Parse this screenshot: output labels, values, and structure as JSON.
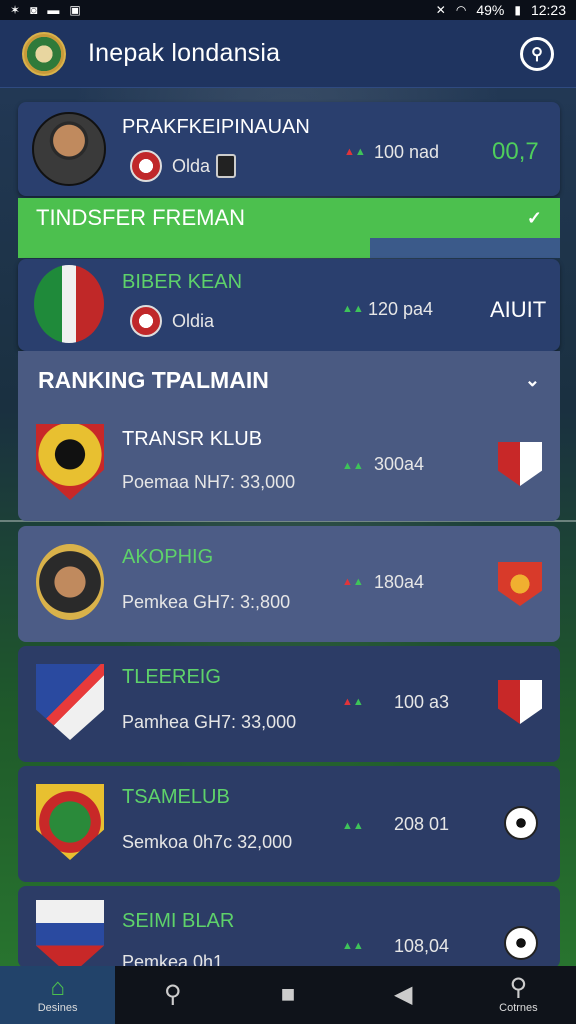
{
  "status": {
    "battery": "49%",
    "time": "12:23"
  },
  "header": {
    "title": "Inepak londansia"
  },
  "featured": {
    "name": "PRAKFKEIPINAUAN",
    "club": "Olda",
    "delta": "100 nad",
    "score": "00,7"
  },
  "transfer": {
    "title": "TINDSFER FREMAN",
    "progress": 0.65
  },
  "transfer_row": {
    "name": "BIBER KEAN",
    "club": "Oldia",
    "delta": "120 pa4",
    "score": "AIUIT"
  },
  "ranking": {
    "title": "RANKING TPALMAIN"
  },
  "rows": [
    {
      "name": "TRANSR KLUB",
      "sub": "Poemaa NH7: 33,000",
      "delta": "300a4"
    },
    {
      "name": "AKOPHIG",
      "sub": "Pemkea GH7: 3:,800",
      "delta": "180a4"
    },
    {
      "name": "TLEEREIG",
      "sub": "Pamhea GH7: 33,000",
      "delta": "100 a3"
    },
    {
      "name": "TSAMELUB",
      "sub": "Semkoa 0h7c 32,000",
      "delta": "208 01"
    },
    {
      "name": "SEIMI BLAR",
      "sub": "Pemkea 0h1",
      "delta": "108,04"
    }
  ],
  "nav": [
    {
      "label": "Desines",
      "icon": "home-icon"
    },
    {
      "label": "",
      "icon": "search-icon"
    },
    {
      "label": "",
      "icon": "square-icon"
    },
    {
      "label": "",
      "icon": "back-icon"
    },
    {
      "label": "Cotrnes",
      "icon": "search-icon"
    }
  ],
  "colors": {
    "accent": "#4cc04e",
    "panel": "#2a3f6e",
    "appbar": "#1f3460"
  }
}
